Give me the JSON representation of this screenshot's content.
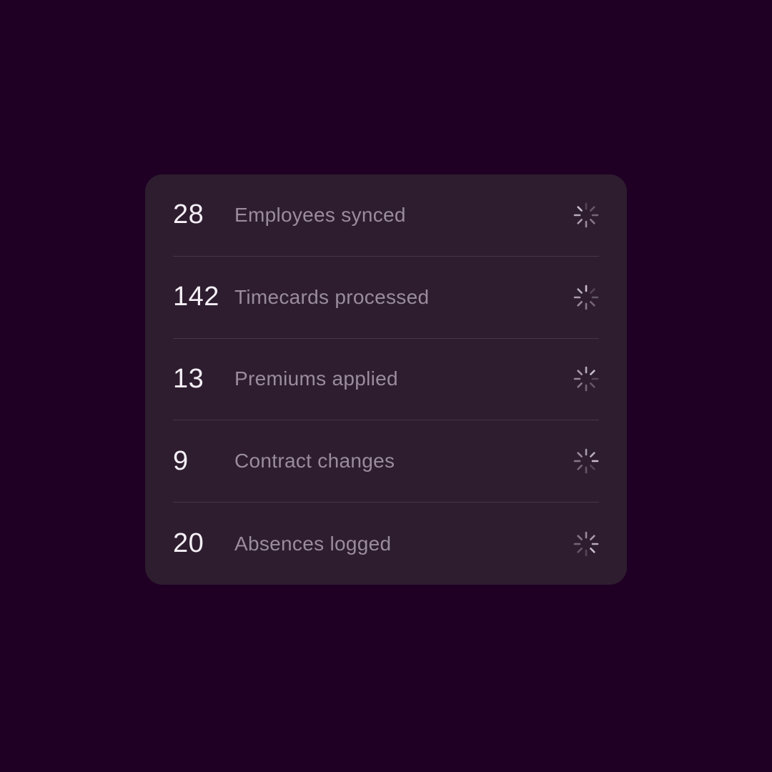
{
  "colors": {
    "background": "#1f0024",
    "card": "#2d1d2f",
    "divider": "#463848",
    "count_text": "#f5eff6",
    "label_text": "#9a8c9c",
    "spinner": "#c9bdca"
  },
  "rows": [
    {
      "count": "28",
      "label": "Employees synced",
      "status_icon": "loading-spinner-icon"
    },
    {
      "count": "142",
      "label": "Timecards processed",
      "status_icon": "loading-spinner-icon"
    },
    {
      "count": "13",
      "label": "Premiums applied",
      "status_icon": "loading-spinner-icon"
    },
    {
      "count": "9",
      "label": "Contract changes",
      "status_icon": "loading-spinner-icon"
    },
    {
      "count": "20",
      "label": "Absences logged",
      "status_icon": "loading-spinner-icon"
    }
  ]
}
